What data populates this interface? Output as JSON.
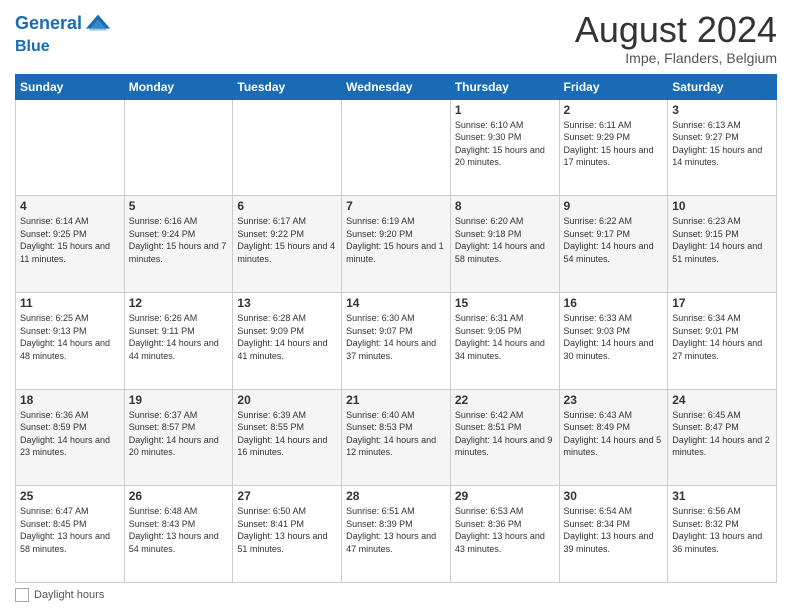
{
  "header": {
    "logo_line1": "General",
    "logo_line2": "Blue",
    "title": "August 2024",
    "subtitle": "Impe, Flanders, Belgium"
  },
  "weekdays": [
    "Sunday",
    "Monday",
    "Tuesday",
    "Wednesday",
    "Thursday",
    "Friday",
    "Saturday"
  ],
  "weeks": [
    [
      {
        "day": "",
        "info": ""
      },
      {
        "day": "",
        "info": ""
      },
      {
        "day": "",
        "info": ""
      },
      {
        "day": "",
        "info": ""
      },
      {
        "day": "1",
        "info": "Sunrise: 6:10 AM\nSunset: 9:30 PM\nDaylight: 15 hours and 20 minutes."
      },
      {
        "day": "2",
        "info": "Sunrise: 6:11 AM\nSunset: 9:29 PM\nDaylight: 15 hours and 17 minutes."
      },
      {
        "day": "3",
        "info": "Sunrise: 6:13 AM\nSunset: 9:27 PM\nDaylight: 15 hours and 14 minutes."
      }
    ],
    [
      {
        "day": "4",
        "info": "Sunrise: 6:14 AM\nSunset: 9:25 PM\nDaylight: 15 hours and 11 minutes."
      },
      {
        "day": "5",
        "info": "Sunrise: 6:16 AM\nSunset: 9:24 PM\nDaylight: 15 hours and 7 minutes."
      },
      {
        "day": "6",
        "info": "Sunrise: 6:17 AM\nSunset: 9:22 PM\nDaylight: 15 hours and 4 minutes."
      },
      {
        "day": "7",
        "info": "Sunrise: 6:19 AM\nSunset: 9:20 PM\nDaylight: 15 hours and 1 minute."
      },
      {
        "day": "8",
        "info": "Sunrise: 6:20 AM\nSunset: 9:18 PM\nDaylight: 14 hours and 58 minutes."
      },
      {
        "day": "9",
        "info": "Sunrise: 6:22 AM\nSunset: 9:17 PM\nDaylight: 14 hours and 54 minutes."
      },
      {
        "day": "10",
        "info": "Sunrise: 6:23 AM\nSunset: 9:15 PM\nDaylight: 14 hours and 51 minutes."
      }
    ],
    [
      {
        "day": "11",
        "info": "Sunrise: 6:25 AM\nSunset: 9:13 PM\nDaylight: 14 hours and 48 minutes."
      },
      {
        "day": "12",
        "info": "Sunrise: 6:26 AM\nSunset: 9:11 PM\nDaylight: 14 hours and 44 minutes."
      },
      {
        "day": "13",
        "info": "Sunrise: 6:28 AM\nSunset: 9:09 PM\nDaylight: 14 hours and 41 minutes."
      },
      {
        "day": "14",
        "info": "Sunrise: 6:30 AM\nSunset: 9:07 PM\nDaylight: 14 hours and 37 minutes."
      },
      {
        "day": "15",
        "info": "Sunrise: 6:31 AM\nSunset: 9:05 PM\nDaylight: 14 hours and 34 minutes."
      },
      {
        "day": "16",
        "info": "Sunrise: 6:33 AM\nSunset: 9:03 PM\nDaylight: 14 hours and 30 minutes."
      },
      {
        "day": "17",
        "info": "Sunrise: 6:34 AM\nSunset: 9:01 PM\nDaylight: 14 hours and 27 minutes."
      }
    ],
    [
      {
        "day": "18",
        "info": "Sunrise: 6:36 AM\nSunset: 8:59 PM\nDaylight: 14 hours and 23 minutes."
      },
      {
        "day": "19",
        "info": "Sunrise: 6:37 AM\nSunset: 8:57 PM\nDaylight: 14 hours and 20 minutes."
      },
      {
        "day": "20",
        "info": "Sunrise: 6:39 AM\nSunset: 8:55 PM\nDaylight: 14 hours and 16 minutes."
      },
      {
        "day": "21",
        "info": "Sunrise: 6:40 AM\nSunset: 8:53 PM\nDaylight: 14 hours and 12 minutes."
      },
      {
        "day": "22",
        "info": "Sunrise: 6:42 AM\nSunset: 8:51 PM\nDaylight: 14 hours and 9 minutes."
      },
      {
        "day": "23",
        "info": "Sunrise: 6:43 AM\nSunset: 8:49 PM\nDaylight: 14 hours and 5 minutes."
      },
      {
        "day": "24",
        "info": "Sunrise: 6:45 AM\nSunset: 8:47 PM\nDaylight: 14 hours and 2 minutes."
      }
    ],
    [
      {
        "day": "25",
        "info": "Sunrise: 6:47 AM\nSunset: 8:45 PM\nDaylight: 13 hours and 58 minutes."
      },
      {
        "day": "26",
        "info": "Sunrise: 6:48 AM\nSunset: 8:43 PM\nDaylight: 13 hours and 54 minutes."
      },
      {
        "day": "27",
        "info": "Sunrise: 6:50 AM\nSunset: 8:41 PM\nDaylight: 13 hours and 51 minutes."
      },
      {
        "day": "28",
        "info": "Sunrise: 6:51 AM\nSunset: 8:39 PM\nDaylight: 13 hours and 47 minutes."
      },
      {
        "day": "29",
        "info": "Sunrise: 6:53 AM\nSunset: 8:36 PM\nDaylight: 13 hours and 43 minutes."
      },
      {
        "day": "30",
        "info": "Sunrise: 6:54 AM\nSunset: 8:34 PM\nDaylight: 13 hours and 39 minutes."
      },
      {
        "day": "31",
        "info": "Sunrise: 6:56 AM\nSunset: 8:32 PM\nDaylight: 13 hours and 36 minutes."
      }
    ]
  ],
  "footer": {
    "box_label": "Daylight hours"
  }
}
